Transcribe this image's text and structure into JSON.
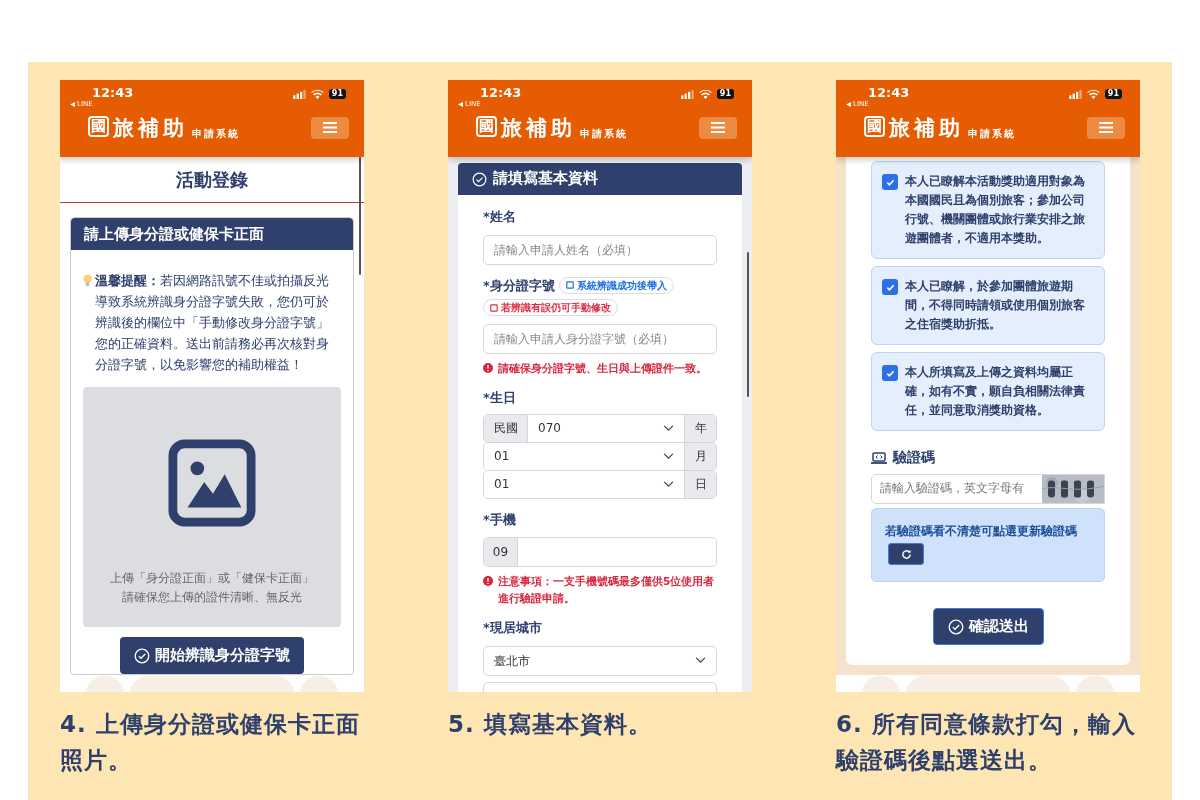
{
  "steps": [
    {
      "kind": "upload",
      "browser_bar": true,
      "status": {
        "time": "12:43",
        "back_app": "LINE",
        "battery": "91"
      },
      "logo": {
        "mark": "國",
        "name": "旅補助",
        "sub": "申請系統"
      },
      "page_title": "活動登錄",
      "card_title": "請上傳身分證或健保卡正面",
      "tip": "**溫馨提醒：**若因網路訊號不佳或拍攝反光導致系統辨識身分證字號失敗，您仍可於辨識後的欄位中「手動修改身分證字號」您的正確資料。送出前請務必再次核對身分證字號，以免影響您的補助權益！",
      "upload_lines": [
        "上傳「身分證正面」或「健保卡正面」",
        "請確保您上傳的證件清晰、無反光"
      ],
      "button": "開始辨識身分證字號",
      "caption": "4. 上傳身分證或健保卡正面照片。"
    },
    {
      "kind": "form",
      "browser_bar": false,
      "status": {
        "time": "12:43",
        "back_app": "LINE",
        "battery": "91"
      },
      "logo": {
        "mark": "國",
        "name": "旅補助",
        "sub": "申請系統"
      },
      "card_title": "請填寫基本資料",
      "fields": [
        {
          "kind": "text",
          "label": "*姓名",
          "placeholder": "請輸入申請人姓名（必填）"
        },
        {
          "kind": "text",
          "label": "*身分證字號",
          "badges": [
            {
              "text": "系統辨識成功後帶入",
              "color": "#1d6fe0"
            },
            {
              "text": "若辨識有誤仍可手動修改",
              "color": "#dc2f45"
            }
          ],
          "placeholder": "請輸入申請人身分證字號（必填）",
          "note": "請確保身分證字號、生日與上傳證件一致。"
        },
        {
          "kind": "date",
          "label": "*生日",
          "rows": [
            {
              "prefix": "民國",
              "value": "070",
              "suffix": "年"
            },
            {
              "value": "01",
              "suffix": "月"
            },
            {
              "value": "01",
              "suffix": "日"
            }
          ]
        },
        {
          "kind": "phone",
          "label": "*手機",
          "prefix": "09",
          "note": "注意事項：一支手機號碼最多僅供5位使用者進行驗證申請。"
        },
        {
          "kind": "select",
          "label": "*現居城市",
          "value": "臺北市"
        }
      ],
      "caption": "5. 填寫基本資料。"
    },
    {
      "kind": "confirm",
      "browser_bar": true,
      "status": {
        "time": "12:43",
        "back_app": "LINE",
        "battery": "91"
      },
      "logo": {
        "mark": "國",
        "name": "旅補助",
        "sub": "申請系統"
      },
      "agreements": [
        {
          "text": "本人已瞭解本活動獎助適用對象為本國國民且為個別旅客；參加公司行號、機關團體或旅行業安排之旅遊團體者，不適用本獎助。",
          "checked": true
        },
        {
          "text": "本人已瞭解，於參加團體旅遊期間，不得同時請領或使用個別旅客之住宿獎助折抵。",
          "checked": true
        },
        {
          "text": "本人所填寫及上傳之資料均屬正確，如有不實，願自負相關法律責任，並同意取消獎助資格。",
          "checked": true
        }
      ],
      "captcha": {
        "label": "驗證碼",
        "placeholder": "請輸入驗證碼，英文字母有",
        "hint": "若驗證碼看不清楚可點選更新驗證碼"
      },
      "button": "確認送出",
      "caption": "6. 所有同意條款打勾，輸入驗證碼後點選送出。"
    }
  ]
}
